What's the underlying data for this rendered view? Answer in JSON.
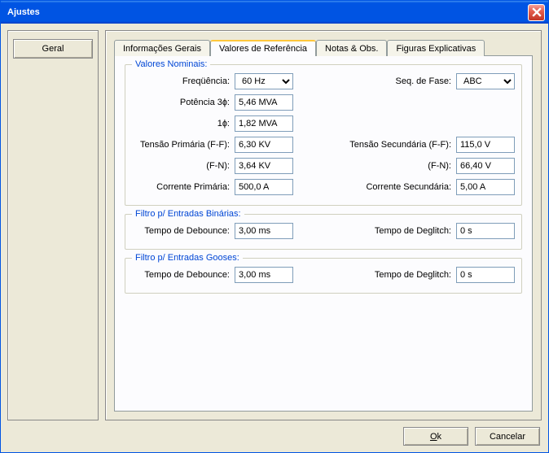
{
  "window": {
    "title": "Ajustes"
  },
  "sidebar": {
    "geral": "Geral"
  },
  "tabs": {
    "info": "Informações Gerais",
    "valores": "Valores de Referência",
    "notas": "Notas & Obs.",
    "figuras": "Figuras Explicativas"
  },
  "groups": {
    "nominais": {
      "title": "Valores Nominais:",
      "freq_label": "Freqüência:",
      "freq_value": "60 Hz",
      "seq_label": "Seq. de Fase:",
      "seq_value": "ABC",
      "pot3_label": "Potência 3ɸ:",
      "pot3_value": "5,46 MVA",
      "pot1_label": "1ɸ:",
      "pot1_value": "1,82 MVA",
      "tensp_label": "Tensão Primária (F-F):",
      "tensp_value": "6,30 KV",
      "tenss_label": "Tensão Secundária (F-F):",
      "tenss_value": "115,0 V",
      "fnp_label": "(F-N):",
      "fnp_value": "3,64 KV",
      "fns_label": "(F-N):",
      "fns_value": "66,40 V",
      "corrp_label": "Corrente Primária:",
      "corrp_value": "500,0 A",
      "corrs_label": "Corrente Secundária:",
      "corrs_value": "5,00 A"
    },
    "binarias": {
      "title": "Filtro p/ Entradas Binárias:",
      "debounce_label": "Tempo de Debounce:",
      "debounce_value": "3,00 ms",
      "deglitch_label": "Tempo de Deglitch:",
      "deglitch_value": "0 s"
    },
    "gooses": {
      "title": "Filtro p/ Entradas Gooses:",
      "debounce_label": "Tempo de Debounce:",
      "debounce_value": "3,00 ms",
      "deglitch_label": "Tempo de Deglitch:",
      "deglitch_value": "0 s"
    }
  },
  "footer": {
    "ok": "Ok",
    "cancel": "Cancelar"
  }
}
